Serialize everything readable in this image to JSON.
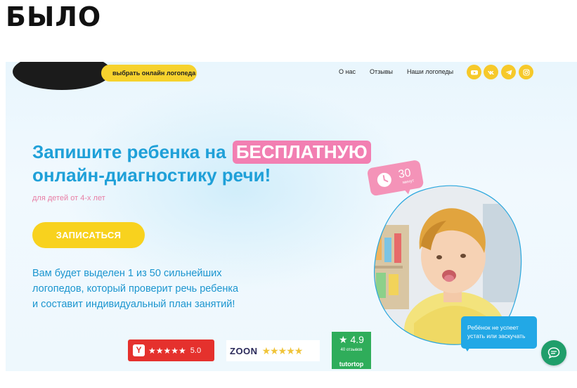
{
  "caption": "БЫЛО",
  "header": {
    "choose_button": "выбрать онлайн логопеда",
    "nav": [
      "О нас",
      "Отзывы",
      "Наши логопеды"
    ],
    "social_icons": [
      "youtube-icon",
      "vk-icon",
      "telegram-icon",
      "instagram-icon"
    ]
  },
  "hero": {
    "headline_part1": "Запишите ребенка на",
    "headline_highlight": "БЕСПЛАТНУЮ",
    "headline_part2": "онлайн-диагностику речи!",
    "subline": "для детей от 4-х лет",
    "cta": "ЗАПИСАТЬСЯ",
    "description": [
      "Вам будет выделен 1 из 50 сильнейших",
      "логопедов, который проверит речь ребенка",
      "и составит индивидуальный план занятий!"
    ]
  },
  "timer": {
    "minutes": "30",
    "unit": "минут"
  },
  "bubble": {
    "line1": "Ребёнок не успеет",
    "line2": "устать или заскучать"
  },
  "ratings": {
    "yandex": {
      "logo": "Y",
      "stars": "★★★★★",
      "score": "5.0"
    },
    "zoon": {
      "logo": "ZOON",
      "stars": "★★★★★"
    },
    "tutortop": {
      "score": "★ 4.9",
      "reviews": "40 отзывов",
      "name": "tutortop"
    }
  },
  "colors": {
    "accent_yellow": "#f8d21e",
    "headline_blue": "#1fa0d8",
    "highlight_pink": "#f27fb2",
    "chat_green": "#1f9e6a"
  }
}
